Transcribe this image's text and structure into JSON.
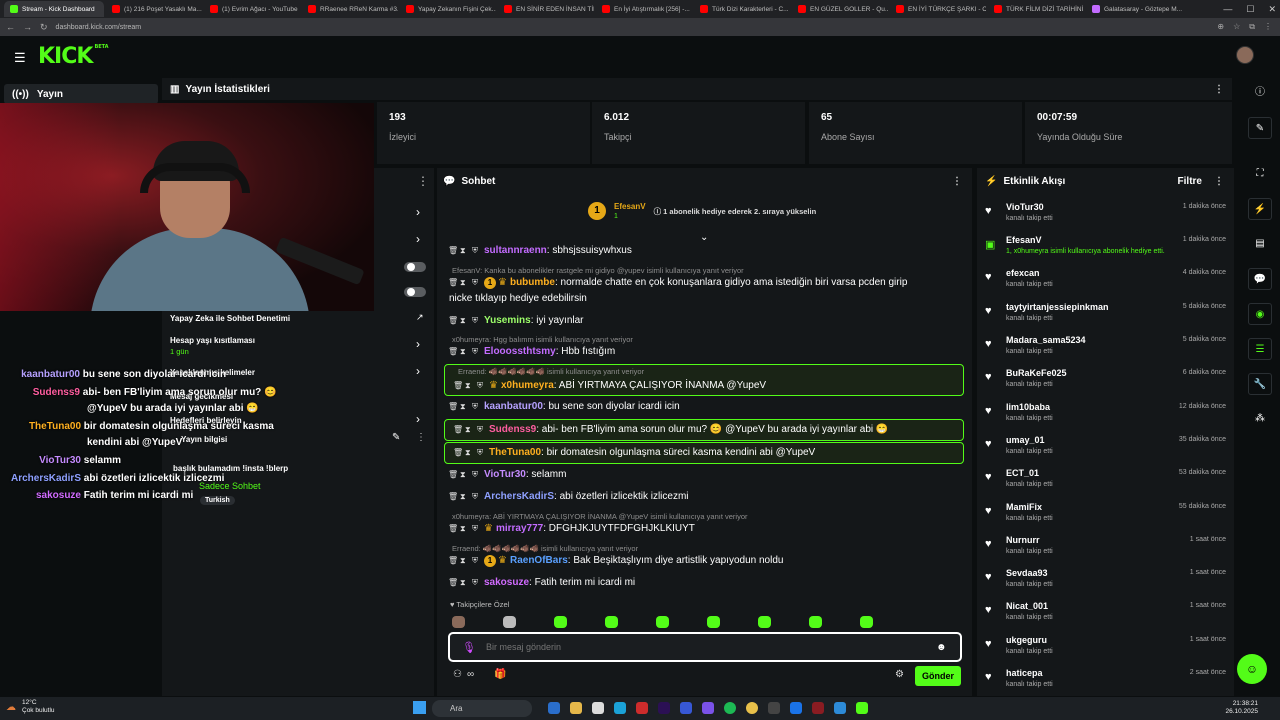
{
  "browser": {
    "tabs": [
      {
        "label": "Stream - Kick Dashboard",
        "color": "#53fc18",
        "active": true
      },
      {
        "label": "(1) 216 Poşet Yasaklı Ma...",
        "color": "#ff0000"
      },
      {
        "label": "(1) Evrim Ağacı - YouTube",
        "color": "#ff0000"
      },
      {
        "label": "RRaenee RReN Karma #3...",
        "color": "#ff0000"
      },
      {
        "label": "Yapay Zekanın Fişini Çek...",
        "color": "#ff0000"
      },
      {
        "label": "EN SİNİR EDEN İNSAN TİP...",
        "color": "#ff0000"
      },
      {
        "label": "En İyi Atıştırmalık [256] -...",
        "color": "#ff0000"
      },
      {
        "label": "Türk Dizi Karakterleri - C...",
        "color": "#ff0000"
      },
      {
        "label": "EN GÜZEL GOLLER - Qu...",
        "color": "#ff0000"
      },
      {
        "label": "EN İYİ TÜRKÇE ŞARKI - C...",
        "color": "#ff0000"
      },
      {
        "label": "TÜRK FİLM DİZİ TARİHİNİ...",
        "color": "#ff0000"
      },
      {
        "label": "Galatasaray - Göztepe M...",
        "color": "#c36cff"
      }
    ],
    "url": "dashboard.kick.com/stream"
  },
  "header": {
    "logo": "KICK",
    "logo_sup": "BETA"
  },
  "sidebar": {
    "active_item": "Yayın"
  },
  "stats": {
    "title": "Yayın İstatistikleri",
    "items": [
      {
        "value": "193",
        "label": "İzleyici"
      },
      {
        "value": "6.012",
        "label": "Takipçi"
      },
      {
        "value": "65",
        "label": "Abone Sayısı"
      },
      {
        "value": "00:07:59",
        "label": "Yayında Olduğu Süre"
      }
    ]
  },
  "settings_panel": {
    "ai_moderation": "Yapay Zeka ile Sohbet Denetimi",
    "account_age": "Hesap yaşı kısıtlaması",
    "account_age_value": "1 gün",
    "banned_words": "Yasaklanmış kelimeler",
    "delay": "Mesaj gecikmesi",
    "goals": "Hedefleri belirleyin",
    "stream_info": "Yayın bilgisi",
    "stream_title": "başlık bulamadım !insta !blerp",
    "category": "Sadece Sohbet",
    "language": "Turkish"
  },
  "overlay_chat": [
    {
      "user": "kaanbatur00",
      "text": "bu sene son diyolar icardi icin",
      "color": "#b6a1ff"
    },
    {
      "user": "Sudenss9",
      "text": "abi- ben FB'liyim ama sorun olur mu? 😊",
      "color": "#ff5ea0"
    },
    {
      "user": "",
      "text": "@YupeV bu arada iyi yayınlar abi 😁",
      "color": "#ffffff"
    },
    {
      "user": "TheTuna00",
      "text": "bir domatesin olgunlaşma süreci kasma",
      "color": "#ffb020"
    },
    {
      "user": "",
      "text": "kendini abi @YupeV",
      "color": "#ffffff"
    },
    {
      "user": "VioTur30",
      "text": "selamm",
      "color": "#c58cff"
    },
    {
      "user": "ArchersKadirS",
      "text": "abi özetleri izlicektik izlicezmi",
      "color": "#8ea0ff"
    },
    {
      "user": "sakosuze",
      "text": "Fatih terim mi icardi mi",
      "color": "#d16bff"
    }
  ],
  "chat": {
    "title": "Sohbet",
    "pinned": {
      "name": "EfesanV",
      "count": "1",
      "text": "1 abonelik hediye ederek 2. sıraya yükselin",
      "rank": "1"
    },
    "messages": [
      {
        "user": "sultannraenn",
        "text": ": sbhsjssuisywhxus",
        "color": "#c36cff"
      },
      {
        "reply": "EfesanV: Kanka bu abonelikler rastgele mi gidiyo @yupev isimli kullanıcıya yanıt veriyor"
      },
      {
        "user": "bubumbe",
        "text": ": normalde chatte en çok konuşanlara gidiyo ama istediğin biri varsa pcden girip",
        "color": "#ffb020"
      },
      {
        "text": "nicke tıklayıp hediye edebilirsin"
      },
      {
        "user": "Yusemins",
        "text": ": iyi yayınlar",
        "color": "#9dff6a"
      },
      {
        "reply": "x0humeyra: Hgg balımm isimli kullanıcıya yanıt veriyor"
      },
      {
        "user": "Eloоossthtsmy",
        "text": ": Hbb fıstığım",
        "color": "#c36cff"
      },
      {
        "reply": "Erraend: 🐗🐗🐗🐗🐗🐗 isimli kullanıcıya yanıt veriyor"
      },
      {
        "user": "x0humeyra",
        "text": ": ABİ YIRTMAYA ÇALIŞIYOR İNANMA @YupeV",
        "color": "#ffb020"
      },
      {
        "user": "kaanbatur00",
        "text": ": bu sene son diyolar icardi icin",
        "color": "#b6a1ff"
      },
      {
        "user": "Sudenss9",
        "text": ": abi- ben FB'liyim ama sorun olur mu? 😊 @YupeV bu arada iyi yayınlar abi 😁",
        "color": "#ff5ea0"
      },
      {
        "user": "TheTuna00",
        "text": ": bir domatesin olgunlaşma süreci kasma kendini abi @YupeV",
        "color": "#ffb020"
      },
      {
        "user": "VioTur30",
        "text": ": selamm",
        "color": "#c58cff"
      },
      {
        "user": "ArchersKadirS",
        "text": ": abi özetleri izlicektik izlicezmi",
        "color": "#8ea0ff"
      },
      {
        "reply": "x0humeyra: ABİ YIRTMAYA ÇALIŞIYOR İNANMA @YupeV isimli kullanıcıya yanıt veriyor"
      },
      {
        "user": "mirray777",
        "text": ": DFGHJKJUYTFDFGHJKLKIUYT",
        "color": "#c36cff"
      },
      {
        "reply": "Erraend: 🐗🐗🐗🐗🐗🐗 isimli kullanıcıya yanıt veriyor"
      },
      {
        "user": "RaenOfBars",
        "text": ": Bak Beşiktaşlıyım diye artistlik yapıyodun noldu",
        "color": "#5aa0ff"
      },
      {
        "user": "sakosuze",
        "text": ": Fatih terim mi icardi mi",
        "color": "#d16bff"
      }
    ],
    "followers_only": "Takipçilere Özel",
    "input_placeholder": "Bir mesaj gönderin",
    "send_label": "Gönder"
  },
  "activity": {
    "title": "Etkinlik Akışı",
    "filter": "Filtre",
    "items": [
      {
        "name": "VioTur30",
        "desc": "kanalı takip etti",
        "time": "1 dakika önce"
      },
      {
        "name": "EfesanV",
        "desc": "1, x0humeyra isimli kullanıcıya abonelik hediye etti.",
        "time": "1 dakika önce",
        "sub": true
      },
      {
        "name": "efexcan",
        "desc": "kanalı takip etti",
        "time": "4 dakika önce"
      },
      {
        "name": "taytyirtanjessiepinkman",
        "desc": "kanalı takip etti",
        "time": "5 dakika önce"
      },
      {
        "name": "Madara_sama5234",
        "desc": "kanalı takip etti",
        "time": "5 dakika önce"
      },
      {
        "name": "BuRaKeFe025",
        "desc": "kanalı takip etti",
        "time": "6 dakika önce"
      },
      {
        "name": "lim10baba",
        "desc": "kanalı takip etti",
        "time": "12 dakika önce"
      },
      {
        "name": "umay_01",
        "desc": "kanalı takip etti",
        "time": "35 dakika önce"
      },
      {
        "name": "ECT_01",
        "desc": "kanalı takip etti",
        "time": "53 dakika önce"
      },
      {
        "name": "MamiFix",
        "desc": "kanalı takip etti",
        "time": "55 dakika önce"
      },
      {
        "name": "Nurnurr",
        "desc": "kanalı takip etti",
        "time": "1 saat önce"
      },
      {
        "name": "Sevdaa93",
        "desc": "kanalı takip etti",
        "time": "1 saat önce"
      },
      {
        "name": "Nicat_001",
        "desc": "kanalı takip etti",
        "time": "1 saat önce"
      },
      {
        "name": "ukgeguru",
        "desc": "kanalı takip etti",
        "time": "1 saat önce"
      },
      {
        "name": "haticepa",
        "desc": "kanalı takip etti",
        "time": "2 saat önce"
      }
    ]
  },
  "taskbar": {
    "weather_temp": "12°C",
    "weather_desc": "Çok bulutlu",
    "search": "Ara",
    "time": "21:38:21",
    "date": "26.10.2025"
  }
}
